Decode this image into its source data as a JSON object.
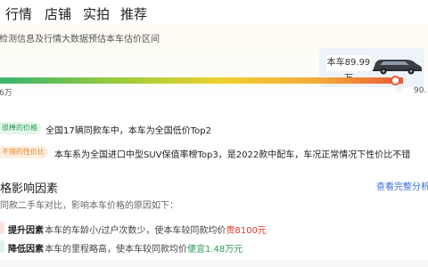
{
  "tabs": [
    {
      "label": "行情",
      "active": true
    },
    {
      "label": "店铺",
      "active": false
    },
    {
      "label": "实拍",
      "active": false
    },
    {
      "label": "推荐",
      "active": false
    }
  ],
  "price_card": {
    "description": "检测信息及行情大数据预估本车估价区间",
    "car_price_label": "本车89.99万",
    "scale_min": "6万",
    "scale_max": "90.",
    "car_price_position": 0.982
  },
  "highlights": [
    {
      "badge": "很棒的价格",
      "badge_color": "#2b9a55",
      "text": "全国17辆同款车中，本车为全国低价Top2"
    },
    {
      "badge": "不错的性价比",
      "badge_color": "#e08a2a",
      "text": "本车系为全国进口中型SUV保值率榜Top3，是2022款中配车，车况正常情况下性价比不错"
    }
  ],
  "factors": {
    "title": "格影响因素",
    "link": "查看完整分析",
    "compare_text": "同款二手车对比，影响本车价格的原因如下：",
    "items": [
      {
        "label": "提升因素",
        "text": "本车的车龄小/过户次数少，使本车较同款均价",
        "delta": "贵8100元",
        "direction": "up",
        "color": "#e0392b"
      },
      {
        "label": "降低因素",
        "text": "本车的里程略高，使本车较同款均价",
        "delta": "便宜1.48万元",
        "direction": "down",
        "color": "#2b9a55"
      }
    ]
  }
}
